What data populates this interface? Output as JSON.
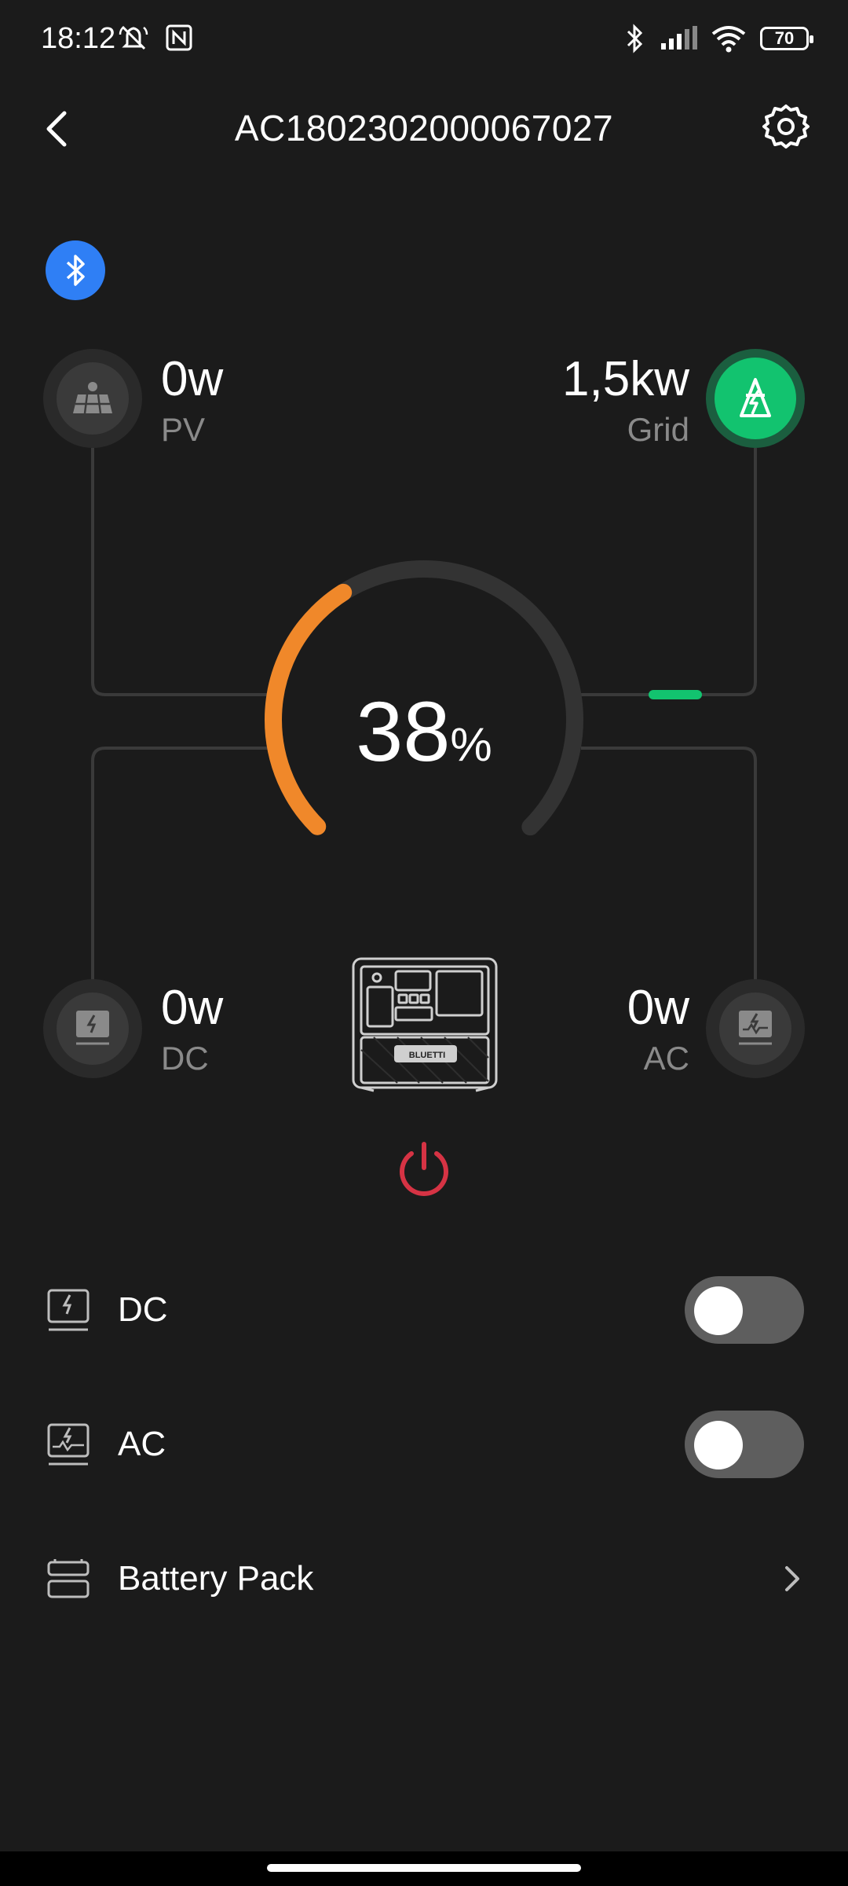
{
  "status_bar": {
    "time": "18:12",
    "battery": "70",
    "icons": [
      "mute-icon",
      "nfc-icon",
      "bluetooth-icon",
      "signal-icon",
      "wifi-icon",
      "battery-icon"
    ]
  },
  "header": {
    "title": "AC1802302000067027",
    "back_icon": "back-arrow-icon",
    "settings_icon": "gear-icon"
  },
  "connection": {
    "icon": "bluetooth-icon",
    "color": "#2f7ff5"
  },
  "energy_flow": {
    "pv": {
      "value": "0w",
      "label": "PV",
      "icon": "solar-panel-icon"
    },
    "grid": {
      "value": "1,5kw",
      "label": "Grid",
      "icon": "grid-tower-icon",
      "color": "#12c36f"
    },
    "dc": {
      "value": "0w",
      "label": "DC",
      "icon": "dc-output-icon"
    },
    "ac": {
      "value": "0w",
      "label": "AC",
      "icon": "ac-output-icon"
    },
    "battery_percent": "38",
    "percent_sign": "%",
    "battery_level": 0.38,
    "arc_color": "#f0882a",
    "device_icon": "power-station-icon",
    "device_brand": "BLUETTI"
  },
  "power_button": {
    "icon": "power-icon",
    "color": "#d63344"
  },
  "controls": [
    {
      "label": "DC",
      "type": "toggle",
      "on": false,
      "icon": "dc-output-icon"
    },
    {
      "label": "AC",
      "type": "toggle",
      "on": false,
      "icon": "ac-output-icon"
    },
    {
      "label": "Battery Pack",
      "type": "link",
      "icon": "battery-pack-icon"
    }
  ]
}
